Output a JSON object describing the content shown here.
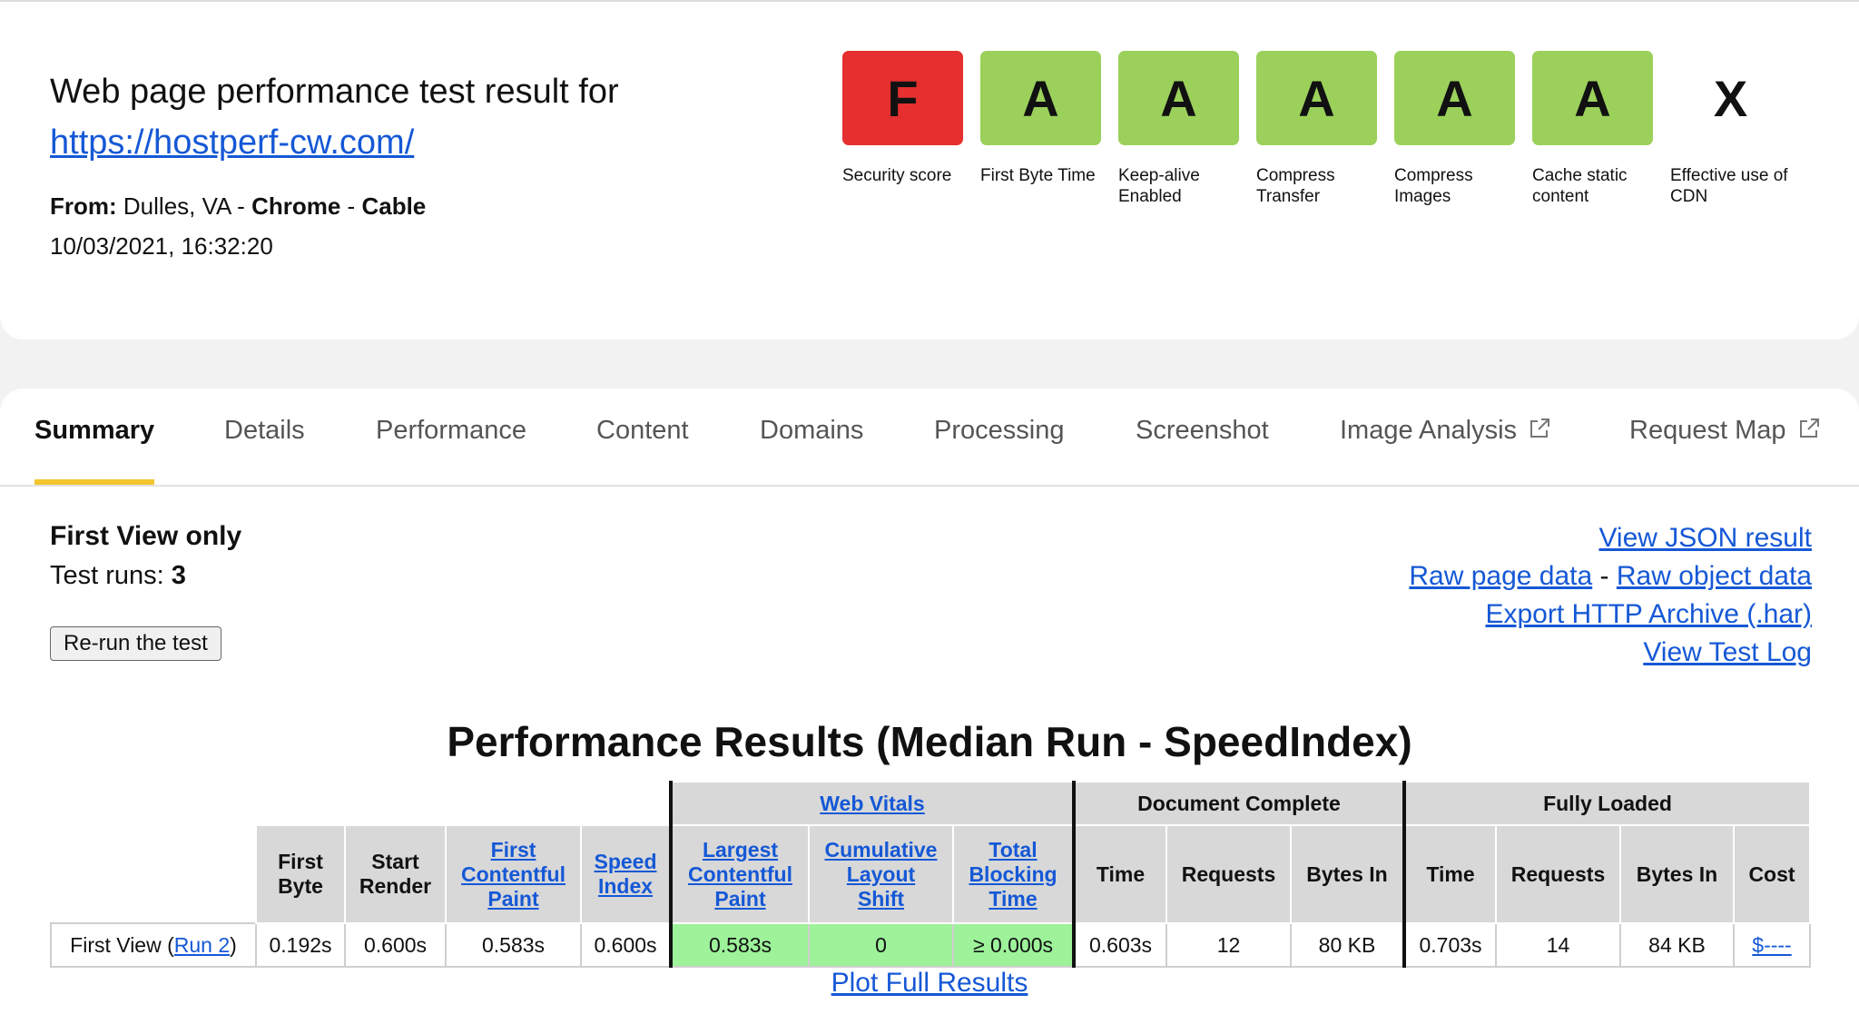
{
  "header": {
    "title": "Web page performance test result for",
    "url": "https://hostperf-cw.com/",
    "from_label": "From:",
    "from_location": "Dulles, VA",
    "dash": "-",
    "browser": "Chrome",
    "connection": "Cable",
    "date": "10/03/2021, 16:32:20"
  },
  "grades": [
    {
      "grade": "F",
      "label_1": "Security score",
      "label_2": "",
      "color": "#e5302f"
    },
    {
      "grade": "A",
      "label_1": "First Byte Time",
      "label_2": "",
      "color": "#9bd15b"
    },
    {
      "grade": "A",
      "label_1": "Keep-alive",
      "label_2": "Enabled",
      "color": "#9bd15b"
    },
    {
      "grade": "A",
      "label_1": "Compress",
      "label_2": "Transfer",
      "color": "#9bd15b"
    },
    {
      "grade": "A",
      "label_1": "Compress",
      "label_2": "Images",
      "color": "#9bd15b"
    },
    {
      "grade": "A",
      "label_1": "Cache static",
      "label_2": "content",
      "color": "#9bd15b"
    },
    {
      "grade": "X",
      "label_1": "Effective use of",
      "label_2": "CDN",
      "color": "#ffffff"
    }
  ],
  "tabs": [
    "Summary",
    "Details",
    "Performance",
    "Content",
    "Domains",
    "Processing",
    "Screenshot",
    "Image Analysis",
    "Request Map"
  ],
  "summary": {
    "view_title": "First View only",
    "test_runs_label": "Test runs:",
    "test_runs_value": "3",
    "rerun_button": "Re-run the test"
  },
  "links": {
    "json": "View JSON result",
    "raw_page": "Raw page data",
    "dash": "-",
    "raw_object": "Raw object data",
    "har": "Export HTTP Archive (.har)",
    "log": "View Test Log"
  },
  "results": {
    "title": "Performance Results (Median Run - SpeedIndex)",
    "group_headers": {
      "web_vitals": "Web Vitals",
      "document_complete": "Document Complete",
      "fully_loaded": "Fully Loaded"
    },
    "col_headers": {
      "first_byte_1": "First",
      "first_byte_2": "Byte",
      "start_render_1": "Start",
      "start_render_2": "Render",
      "fcp_1": "First",
      "fcp_2": "Contentful",
      "fcp_3": "Paint",
      "si_1": "Speed",
      "si_2": "Index",
      "lcp_1": "Largest",
      "lcp_2": "Contentful",
      "lcp_3": "Paint",
      "cls_1": "Cumulative",
      "cls_2": "Layout",
      "cls_3": "Shift",
      "tbt_1": "Total",
      "tbt_2": "Blocking",
      "tbt_3": "Time",
      "dc_time": "Time",
      "dc_requests": "Requests",
      "dc_bytes": "Bytes In",
      "fl_time": "Time",
      "fl_requests": "Requests",
      "fl_bytes": "Bytes In",
      "fl_cost": "Cost"
    },
    "row": {
      "label_prefix": "First View (",
      "run_link": "Run 2",
      "label_suffix": ")",
      "first_byte": "0.192s",
      "start_render": "0.600s",
      "fcp": "0.583s",
      "speed_index": "0.600s",
      "lcp": "0.583s",
      "cls": "0",
      "tbt": "≥ 0.000s",
      "dc_time": "0.603s",
      "dc_requests": "12",
      "dc_bytes": "80 KB",
      "fl_time": "0.703s",
      "fl_requests": "14",
      "fl_bytes": "84 KB",
      "cost": "$----"
    },
    "plot_link": "Plot Full Results"
  }
}
